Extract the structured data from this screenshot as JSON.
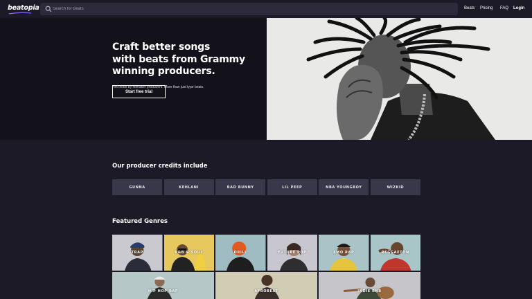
{
  "brand": {
    "name": "beatopia",
    "accent": "#8b5cf6"
  },
  "search": {
    "placeholder": "Search for Beats",
    "icon": "search-icon"
  },
  "nav": [
    {
      "label": "Beats"
    },
    {
      "label": "Pricing"
    },
    {
      "label": "FAQ"
    },
    {
      "label": "Login"
    }
  ],
  "hero": {
    "title_lines": [
      "Craft better songs",
      "with beats from Grammy",
      "winning producers."
    ],
    "subtitle": "Hot beats by hitmaker producers. More than just type beats.",
    "cta_label": "Start free trial"
  },
  "credits": {
    "title": "Our producer credits include",
    "items": [
      "GUNNA",
      "KEHLANI",
      "BAD BUNNY",
      "LIL PEEP",
      "NBA YOUNGBOY",
      "WIZKID"
    ]
  },
  "genres": {
    "title": "Featured Genres",
    "row1": [
      {
        "label": "TRAP",
        "bg": "#c9c9cf"
      },
      {
        "label": "R&B & SOUL",
        "bg": "#e6c85f"
      },
      {
        "label": "DRILL",
        "bg": "#9ebcc2"
      },
      {
        "label": "FUTURE POP",
        "bg": "#c8c6cf"
      },
      {
        "label": "EMO RAP",
        "bg": "#a9c4c6"
      },
      {
        "label": "REGGAETON",
        "bg": "#a8c5c7"
      }
    ],
    "row2": [
      {
        "label": "HIP HOP/RAP",
        "bg": "#b6c7c7"
      },
      {
        "label": "AFROBEAT",
        "bg": "#d0cdb4"
      },
      {
        "label": "INDIE RNB",
        "bg": "#c6c5ca"
      }
    ]
  },
  "colors": {
    "page_bg": "#1b1a26",
    "hero_bg": "#13121b",
    "chip_bg": "#39384b",
    "search_bg": "#2c2a3b"
  }
}
